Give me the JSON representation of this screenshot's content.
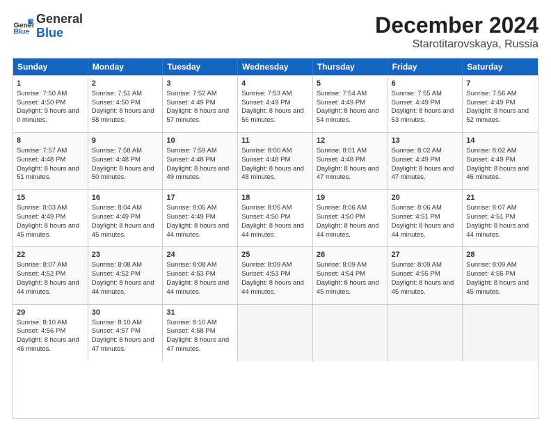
{
  "header": {
    "logo_line1": "General",
    "logo_line2": "Blue",
    "title": "December 2024",
    "subtitle": "Starotitarovskaya, Russia"
  },
  "days_of_week": [
    "Sunday",
    "Monday",
    "Tuesday",
    "Wednesday",
    "Thursday",
    "Friday",
    "Saturday"
  ],
  "weeks": [
    [
      {
        "day": "1",
        "sunrise": "Sunrise: 7:50 AM",
        "sunset": "Sunset: 4:50 PM",
        "daylight": "Daylight: 9 hours and 0 minutes."
      },
      {
        "day": "2",
        "sunrise": "Sunrise: 7:51 AM",
        "sunset": "Sunset: 4:50 PM",
        "daylight": "Daylight: 8 hours and 58 minutes."
      },
      {
        "day": "3",
        "sunrise": "Sunrise: 7:52 AM",
        "sunset": "Sunset: 4:49 PM",
        "daylight": "Daylight: 8 hours and 57 minutes."
      },
      {
        "day": "4",
        "sunrise": "Sunrise: 7:53 AM",
        "sunset": "Sunset: 4:49 PM",
        "daylight": "Daylight: 8 hours and 56 minutes."
      },
      {
        "day": "5",
        "sunrise": "Sunrise: 7:54 AM",
        "sunset": "Sunset: 4:49 PM",
        "daylight": "Daylight: 8 hours and 54 minutes."
      },
      {
        "day": "6",
        "sunrise": "Sunrise: 7:55 AM",
        "sunset": "Sunset: 4:49 PM",
        "daylight": "Daylight: 8 hours and 53 minutes."
      },
      {
        "day": "7",
        "sunrise": "Sunrise: 7:56 AM",
        "sunset": "Sunset: 4:49 PM",
        "daylight": "Daylight: 8 hours and 52 minutes."
      }
    ],
    [
      {
        "day": "8",
        "sunrise": "Sunrise: 7:57 AM",
        "sunset": "Sunset: 4:48 PM",
        "daylight": "Daylight: 8 hours and 51 minutes."
      },
      {
        "day": "9",
        "sunrise": "Sunrise: 7:58 AM",
        "sunset": "Sunset: 4:48 PM",
        "daylight": "Daylight: 8 hours and 50 minutes."
      },
      {
        "day": "10",
        "sunrise": "Sunrise: 7:59 AM",
        "sunset": "Sunset: 4:48 PM",
        "daylight": "Daylight: 8 hours and 49 minutes."
      },
      {
        "day": "11",
        "sunrise": "Sunrise: 8:00 AM",
        "sunset": "Sunset: 4:48 PM",
        "daylight": "Daylight: 8 hours and 48 minutes."
      },
      {
        "day": "12",
        "sunrise": "Sunrise: 8:01 AM",
        "sunset": "Sunset: 4:48 PM",
        "daylight": "Daylight: 8 hours and 47 minutes."
      },
      {
        "day": "13",
        "sunrise": "Sunrise: 8:02 AM",
        "sunset": "Sunset: 4:49 PM",
        "daylight": "Daylight: 8 hours and 47 minutes."
      },
      {
        "day": "14",
        "sunrise": "Sunrise: 8:02 AM",
        "sunset": "Sunset: 4:49 PM",
        "daylight": "Daylight: 8 hours and 46 minutes."
      }
    ],
    [
      {
        "day": "15",
        "sunrise": "Sunrise: 8:03 AM",
        "sunset": "Sunset: 4:49 PM",
        "daylight": "Daylight: 8 hours and 45 minutes."
      },
      {
        "day": "16",
        "sunrise": "Sunrise: 8:04 AM",
        "sunset": "Sunset: 4:49 PM",
        "daylight": "Daylight: 8 hours and 45 minutes."
      },
      {
        "day": "17",
        "sunrise": "Sunrise: 8:05 AM",
        "sunset": "Sunset: 4:49 PM",
        "daylight": "Daylight: 8 hours and 44 minutes."
      },
      {
        "day": "18",
        "sunrise": "Sunrise: 8:05 AM",
        "sunset": "Sunset: 4:50 PM",
        "daylight": "Daylight: 8 hours and 44 minutes."
      },
      {
        "day": "19",
        "sunrise": "Sunrise: 8:06 AM",
        "sunset": "Sunset: 4:50 PM",
        "daylight": "Daylight: 8 hours and 44 minutes."
      },
      {
        "day": "20",
        "sunrise": "Sunrise: 8:06 AM",
        "sunset": "Sunset: 4:51 PM",
        "daylight": "Daylight: 8 hours and 44 minutes."
      },
      {
        "day": "21",
        "sunrise": "Sunrise: 8:07 AM",
        "sunset": "Sunset: 4:51 PM",
        "daylight": "Daylight: 8 hours and 44 minutes."
      }
    ],
    [
      {
        "day": "22",
        "sunrise": "Sunrise: 8:07 AM",
        "sunset": "Sunset: 4:52 PM",
        "daylight": "Daylight: 8 hours and 44 minutes."
      },
      {
        "day": "23",
        "sunrise": "Sunrise: 8:08 AM",
        "sunset": "Sunset: 4:52 PM",
        "daylight": "Daylight: 8 hours and 44 minutes."
      },
      {
        "day": "24",
        "sunrise": "Sunrise: 8:08 AM",
        "sunset": "Sunset: 4:53 PM",
        "daylight": "Daylight: 8 hours and 44 minutes."
      },
      {
        "day": "25",
        "sunrise": "Sunrise: 8:09 AM",
        "sunset": "Sunset: 4:53 PM",
        "daylight": "Daylight: 8 hours and 44 minutes."
      },
      {
        "day": "26",
        "sunrise": "Sunrise: 8:09 AM",
        "sunset": "Sunset: 4:54 PM",
        "daylight": "Daylight: 8 hours and 45 minutes."
      },
      {
        "day": "27",
        "sunrise": "Sunrise: 8:09 AM",
        "sunset": "Sunset: 4:55 PM",
        "daylight": "Daylight: 8 hours and 45 minutes."
      },
      {
        "day": "28",
        "sunrise": "Sunrise: 8:09 AM",
        "sunset": "Sunset: 4:55 PM",
        "daylight": "Daylight: 8 hours and 45 minutes."
      }
    ],
    [
      {
        "day": "29",
        "sunrise": "Sunrise: 8:10 AM",
        "sunset": "Sunset: 4:56 PM",
        "daylight": "Daylight: 8 hours and 46 minutes."
      },
      {
        "day": "30",
        "sunrise": "Sunrise: 8:10 AM",
        "sunset": "Sunset: 4:57 PM",
        "daylight": "Daylight: 8 hours and 47 minutes."
      },
      {
        "day": "31",
        "sunrise": "Sunrise: 8:10 AM",
        "sunset": "Sunset: 4:58 PM",
        "daylight": "Daylight: 8 hours and 47 minutes."
      },
      null,
      null,
      null,
      null
    ]
  ]
}
